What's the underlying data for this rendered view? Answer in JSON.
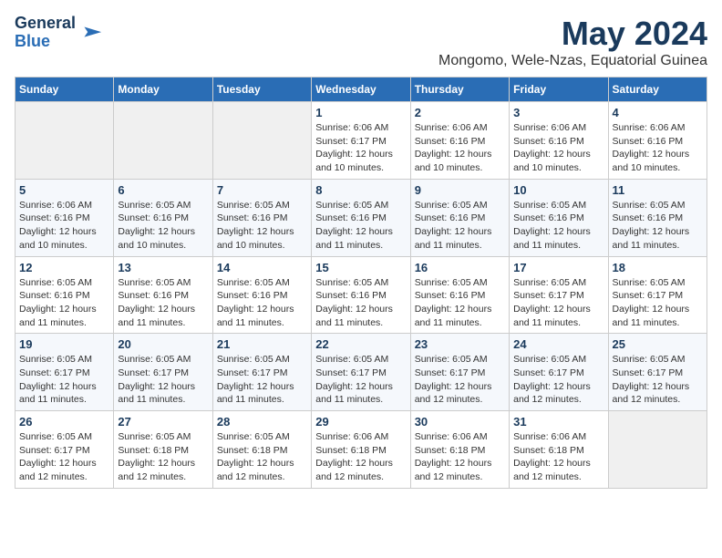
{
  "logo": {
    "line1": "General",
    "line2": "Blue"
  },
  "title": "May 2024",
  "location": "Mongomo, Wele-Nzas, Equatorial Guinea",
  "weekdays": [
    "Sunday",
    "Monday",
    "Tuesday",
    "Wednesday",
    "Thursday",
    "Friday",
    "Saturday"
  ],
  "weeks": [
    [
      {
        "day": "",
        "info": ""
      },
      {
        "day": "",
        "info": ""
      },
      {
        "day": "",
        "info": ""
      },
      {
        "day": "1",
        "info": "Sunrise: 6:06 AM\nSunset: 6:17 PM\nDaylight: 12 hours\nand 10 minutes."
      },
      {
        "day": "2",
        "info": "Sunrise: 6:06 AM\nSunset: 6:16 PM\nDaylight: 12 hours\nand 10 minutes."
      },
      {
        "day": "3",
        "info": "Sunrise: 6:06 AM\nSunset: 6:16 PM\nDaylight: 12 hours\nand 10 minutes."
      },
      {
        "day": "4",
        "info": "Sunrise: 6:06 AM\nSunset: 6:16 PM\nDaylight: 12 hours\nand 10 minutes."
      }
    ],
    [
      {
        "day": "5",
        "info": "Sunrise: 6:06 AM\nSunset: 6:16 PM\nDaylight: 12 hours\nand 10 minutes."
      },
      {
        "day": "6",
        "info": "Sunrise: 6:05 AM\nSunset: 6:16 PM\nDaylight: 12 hours\nand 10 minutes."
      },
      {
        "day": "7",
        "info": "Sunrise: 6:05 AM\nSunset: 6:16 PM\nDaylight: 12 hours\nand 10 minutes."
      },
      {
        "day": "8",
        "info": "Sunrise: 6:05 AM\nSunset: 6:16 PM\nDaylight: 12 hours\nand 11 minutes."
      },
      {
        "day": "9",
        "info": "Sunrise: 6:05 AM\nSunset: 6:16 PM\nDaylight: 12 hours\nand 11 minutes."
      },
      {
        "day": "10",
        "info": "Sunrise: 6:05 AM\nSunset: 6:16 PM\nDaylight: 12 hours\nand 11 minutes."
      },
      {
        "day": "11",
        "info": "Sunrise: 6:05 AM\nSunset: 6:16 PM\nDaylight: 12 hours\nand 11 minutes."
      }
    ],
    [
      {
        "day": "12",
        "info": "Sunrise: 6:05 AM\nSunset: 6:16 PM\nDaylight: 12 hours\nand 11 minutes."
      },
      {
        "day": "13",
        "info": "Sunrise: 6:05 AM\nSunset: 6:16 PM\nDaylight: 12 hours\nand 11 minutes."
      },
      {
        "day": "14",
        "info": "Sunrise: 6:05 AM\nSunset: 6:16 PM\nDaylight: 12 hours\nand 11 minutes."
      },
      {
        "day": "15",
        "info": "Sunrise: 6:05 AM\nSunset: 6:16 PM\nDaylight: 12 hours\nand 11 minutes."
      },
      {
        "day": "16",
        "info": "Sunrise: 6:05 AM\nSunset: 6:16 PM\nDaylight: 12 hours\nand 11 minutes."
      },
      {
        "day": "17",
        "info": "Sunrise: 6:05 AM\nSunset: 6:17 PM\nDaylight: 12 hours\nand 11 minutes."
      },
      {
        "day": "18",
        "info": "Sunrise: 6:05 AM\nSunset: 6:17 PM\nDaylight: 12 hours\nand 11 minutes."
      }
    ],
    [
      {
        "day": "19",
        "info": "Sunrise: 6:05 AM\nSunset: 6:17 PM\nDaylight: 12 hours\nand 11 minutes."
      },
      {
        "day": "20",
        "info": "Sunrise: 6:05 AM\nSunset: 6:17 PM\nDaylight: 12 hours\nand 11 minutes."
      },
      {
        "day": "21",
        "info": "Sunrise: 6:05 AM\nSunset: 6:17 PM\nDaylight: 12 hours\nand 11 minutes."
      },
      {
        "day": "22",
        "info": "Sunrise: 6:05 AM\nSunset: 6:17 PM\nDaylight: 12 hours\nand 11 minutes."
      },
      {
        "day": "23",
        "info": "Sunrise: 6:05 AM\nSunset: 6:17 PM\nDaylight: 12 hours\nand 12 minutes."
      },
      {
        "day": "24",
        "info": "Sunrise: 6:05 AM\nSunset: 6:17 PM\nDaylight: 12 hours\nand 12 minutes."
      },
      {
        "day": "25",
        "info": "Sunrise: 6:05 AM\nSunset: 6:17 PM\nDaylight: 12 hours\nand 12 minutes."
      }
    ],
    [
      {
        "day": "26",
        "info": "Sunrise: 6:05 AM\nSunset: 6:17 PM\nDaylight: 12 hours\nand 12 minutes."
      },
      {
        "day": "27",
        "info": "Sunrise: 6:05 AM\nSunset: 6:18 PM\nDaylight: 12 hours\nand 12 minutes."
      },
      {
        "day": "28",
        "info": "Sunrise: 6:05 AM\nSunset: 6:18 PM\nDaylight: 12 hours\nand 12 minutes."
      },
      {
        "day": "29",
        "info": "Sunrise: 6:06 AM\nSunset: 6:18 PM\nDaylight: 12 hours\nand 12 minutes."
      },
      {
        "day": "30",
        "info": "Sunrise: 6:06 AM\nSunset: 6:18 PM\nDaylight: 12 hours\nand 12 minutes."
      },
      {
        "day": "31",
        "info": "Sunrise: 6:06 AM\nSunset: 6:18 PM\nDaylight: 12 hours\nand 12 minutes."
      },
      {
        "day": "",
        "info": ""
      }
    ]
  ]
}
